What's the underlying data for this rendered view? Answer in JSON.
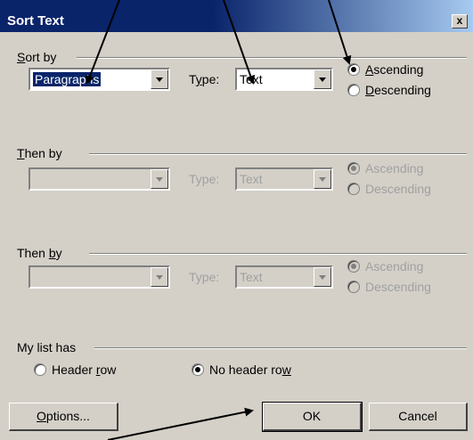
{
  "window": {
    "title": "Sort Text",
    "close_label": "x"
  },
  "sort_by": {
    "label": "Sort by",
    "key_mnemonic": "S",
    "key_rest": "ort by",
    "field_value": "Paragraphs",
    "type_label_pre": "T",
    "type_label_mn": "y",
    "type_label_post": "pe:",
    "type_value": "Text",
    "ascending_mn": "A",
    "ascending_rest": "scending",
    "descending_mn": "D",
    "descending_rest": "escending",
    "selected_order": "Ascending"
  },
  "then_by_1": {
    "label_mn": "T",
    "label_rest": "hen by",
    "field_value": "",
    "type_label": "Type:",
    "type_value": "Text",
    "ascending": "Ascending",
    "descending": "Descending",
    "selected_order": "Ascending",
    "enabled": false
  },
  "then_by_2": {
    "label_pre": "Then ",
    "label_mn": "b",
    "label_post": "y",
    "field_value": "",
    "type_label": "Type:",
    "type_value": "Text",
    "ascending": "Ascending",
    "descending": "Descending",
    "selected_order": "Ascending",
    "enabled": false
  },
  "list_has": {
    "label": "My list has",
    "header_row_pre": "Header ",
    "header_row_mn": "r",
    "header_row_post": "ow",
    "no_header_row_pre": "No header ro",
    "no_header_row_mn": "w",
    "selected": "No header row"
  },
  "buttons": {
    "options_mn": "O",
    "options_rest": "ptions...",
    "ok": "OK",
    "cancel": "Cancel"
  },
  "colors": {
    "titlebar": "#0a246a",
    "dialog_bg": "#d4d0c8",
    "disabled_text": "#a0a0a0"
  }
}
